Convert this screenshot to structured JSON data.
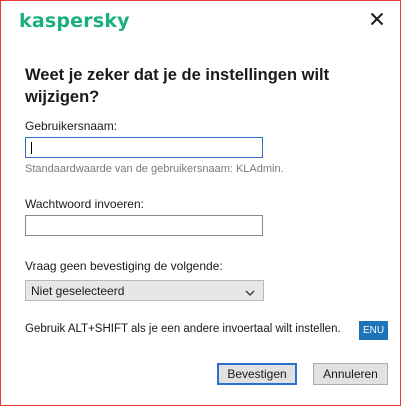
{
  "header": {
    "logo_text": "kaspersky",
    "close_icon": "close-icon"
  },
  "dialog": {
    "title": "Weet je zeker dat je de instellingen wilt wijzigen?",
    "username": {
      "label": "Gebruikersnaam:",
      "value": "",
      "hint": "Standaardwaarde van de gebruikersnaam: KLAdmin."
    },
    "password": {
      "label": "Wachtwoord invoeren:",
      "value": ""
    },
    "confirm": {
      "label": "Vraag geen bevestiging de volgende:",
      "selected": "Niet geselecteerd"
    },
    "language_note": "Gebruik ALT+SHIFT als je een andere invoertaal wilt instellen.",
    "language_badge": "ENU"
  },
  "buttons": {
    "confirm_label": "Bevestigen",
    "cancel_label": "Annuleren"
  },
  "colors": {
    "brand": "#1bb07a",
    "border_accent": "#e8393f",
    "focus": "#2d6fd0",
    "badge": "#1f73b7"
  }
}
